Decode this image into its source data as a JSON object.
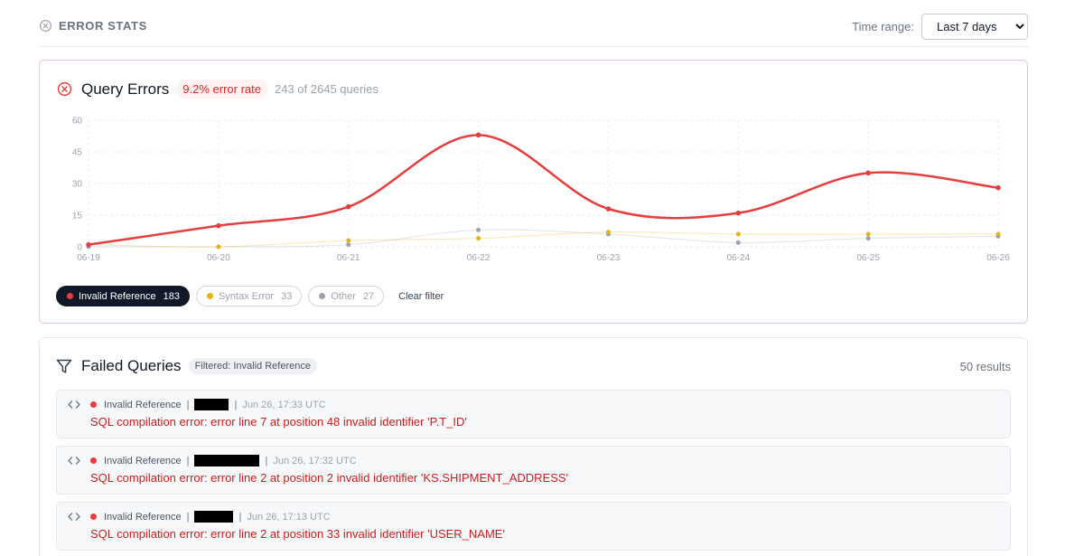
{
  "header": {
    "title": "ERROR STATS",
    "time_range_label": "Time range:",
    "time_range_value": "Last 7 days"
  },
  "query_errors": {
    "title": "Query Errors",
    "error_rate": "9.2% error rate",
    "count_text": "243 of 2645 queries"
  },
  "chart_data": {
    "type": "line",
    "x": [
      "06-19",
      "06-20",
      "06-21",
      "06-22",
      "06-23",
      "06-24",
      "06-25",
      "06-26"
    ],
    "y_ticks": [
      0,
      15,
      30,
      45,
      60
    ],
    "ylim": [
      0,
      60
    ],
    "grid": true,
    "series": [
      {
        "name": "Invalid Reference",
        "color": "#e53e3e",
        "values": [
          1,
          10,
          19,
          53,
          18,
          16,
          35,
          28
        ]
      },
      {
        "name": "Syntax Error",
        "color": "#eab308",
        "values": [
          1,
          0,
          3,
          4,
          7,
          6,
          6,
          6
        ]
      },
      {
        "name": "Other",
        "color": "#9ca3af",
        "values": [
          0,
          0,
          1,
          8,
          6,
          2,
          4,
          5
        ]
      }
    ]
  },
  "legend": {
    "items": [
      {
        "label": "Invalid Reference",
        "count": "183",
        "color": "#e53e3e"
      },
      {
        "label": "Syntax Error",
        "count": "33",
        "color": "#eab308"
      },
      {
        "label": "Other",
        "count": "27",
        "color": "#9ca3af"
      }
    ],
    "clear_label": "Clear filter"
  },
  "failed_queries": {
    "title": "Failed Queries",
    "filter_badge": "Filtered: Invalid Reference",
    "results": "50 results",
    "rows": [
      {
        "type": "Invalid Reference",
        "time": "Jun 26, 17:33 UTC",
        "message": "SQL compilation error: error line 7 at position 48 invalid identifier 'P.T_ID'"
      },
      {
        "type": "Invalid Reference",
        "time": "Jun 26, 17:32 UTC",
        "message": "SQL compilation error: error line 2 at position 2 invalid identifier 'KS.SHIPMENT_ADDRESS'"
      },
      {
        "type": "Invalid Reference",
        "time": "Jun 26, 17:13 UTC",
        "message": "SQL compilation error: error line 2 at position 33 invalid identifier 'USER_NAME'"
      }
    ]
  },
  "colors": {
    "accent_red": "#e53e3e",
    "active_chip": "#111827"
  },
  "icons": {
    "header": "close-circle-icon",
    "errors": "error-circle-icon",
    "failed": "filter-icon",
    "row": "code-icon"
  }
}
